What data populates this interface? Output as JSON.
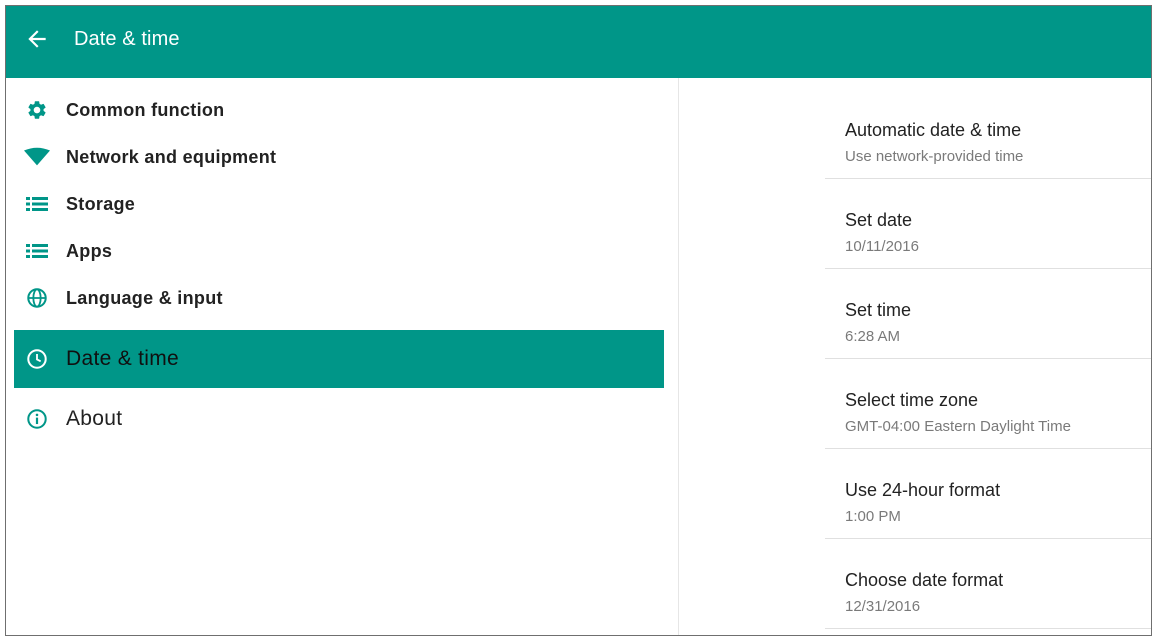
{
  "appbar": {
    "title": "Date & time",
    "back_icon": "arrow-back-icon",
    "color": "#009688"
  },
  "sidebar": {
    "items": [
      {
        "label": "Common function",
        "icon": "gear-icon"
      },
      {
        "label": "Network and equipment",
        "icon": "wifi-icon"
      },
      {
        "label": "Storage",
        "icon": "list-icon"
      },
      {
        "label": "Apps",
        "icon": "list-icon"
      },
      {
        "label": "Language & input",
        "icon": "globe-icon"
      },
      {
        "label": "Date & time",
        "icon": "clock-icon",
        "selected": true
      },
      {
        "label": "About",
        "icon": "info-icon"
      }
    ]
  },
  "settings": [
    {
      "title": "Automatic date & time",
      "subtitle": "Use network-provided time"
    },
    {
      "title": "Set date",
      "subtitle": "10/11/2016"
    },
    {
      "title": "Set time",
      "subtitle": "6:28 AM"
    },
    {
      "title": "Select time zone",
      "subtitle": "GMT-04:00 Eastern Daylight Time"
    },
    {
      "title": "Use 24-hour format",
      "subtitle": "1:00 PM"
    },
    {
      "title": "Choose date format",
      "subtitle": "12/31/2016"
    }
  ]
}
